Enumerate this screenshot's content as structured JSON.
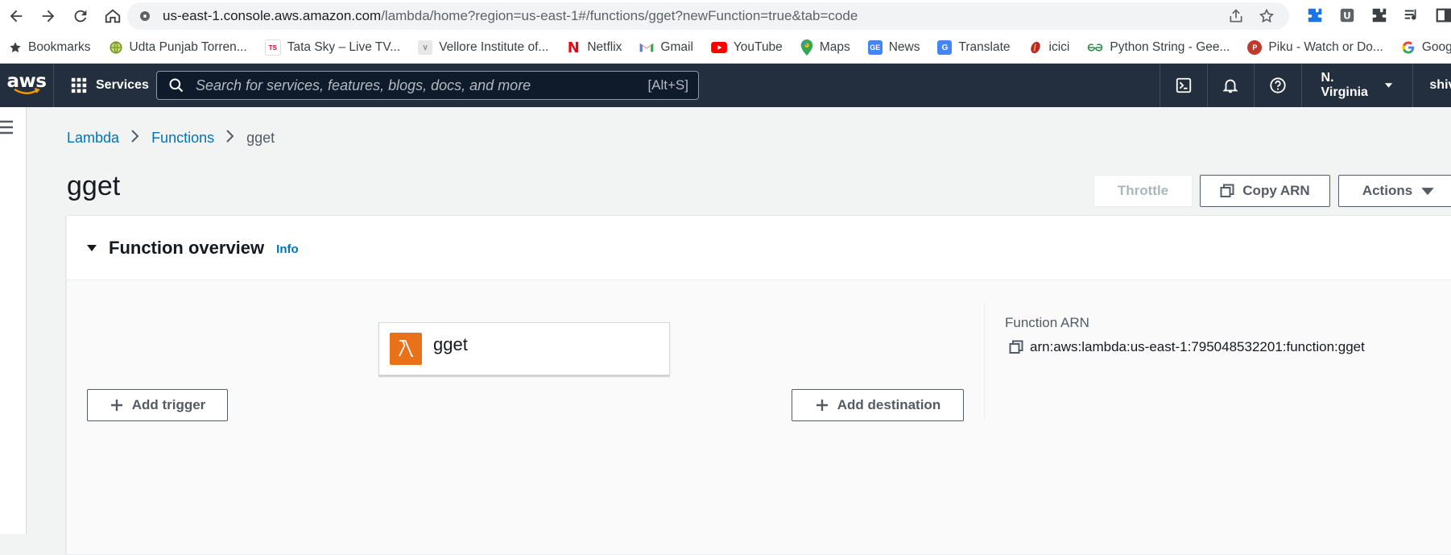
{
  "browser": {
    "url_host": "us-east-1.console.aws.amazon.com",
    "url_path": "/lambda/home?region=us-east-1#/functions/gget?newFunction=true&tab=code",
    "bookmarks": [
      {
        "label": "Bookmarks",
        "icon": "star-icon",
        "color": "#3c4043"
      },
      {
        "label": "Udta Punjab Torren...",
        "icon": "globe-icon",
        "color": "#6b8e23"
      },
      {
        "label": "Tata Sky – Live TV...",
        "icon": "tatasky-icon",
        "color": "#e4002b"
      },
      {
        "label": "Vellore Institute of...",
        "icon": "vit-icon",
        "color": "#7b7b7b"
      },
      {
        "label": "Netflix",
        "icon": "netflix-icon",
        "color": "#e50914"
      },
      {
        "label": "Gmail",
        "icon": "gmail-icon",
        "color": "#ea4335"
      },
      {
        "label": "YouTube",
        "icon": "youtube-icon",
        "color": "#ff0000"
      },
      {
        "label": "Maps",
        "icon": "maps-icon",
        "color": "#34a853"
      },
      {
        "label": "News",
        "icon": "news-icon",
        "color": "#4285f4"
      },
      {
        "label": "Translate",
        "icon": "translate-icon",
        "color": "#4285f4"
      },
      {
        "label": "icici",
        "icon": "icici-icon",
        "color": "#b02a30"
      },
      {
        "label": "Python String - Gee...",
        "icon": "gfg-icon",
        "color": "#2f8d46"
      },
      {
        "label": "Piku - Watch or Do...",
        "icon": "piku-icon",
        "color": "#c0392b"
      },
      {
        "label": "Google",
        "icon": "google-icon",
        "color": "#4285f4"
      }
    ]
  },
  "awsnav": {
    "logo": "aws",
    "services_label": "Services",
    "search_placeholder": "Search for services, features, blogs, docs, and more",
    "search_hint": "[Alt+S]",
    "region": "N. Virginia",
    "user": "shiv"
  },
  "breadcrumb": {
    "items": [
      "Lambda",
      "Functions"
    ],
    "current": "gget"
  },
  "page": {
    "title": "gget",
    "buttons": {
      "throttle": "Throttle",
      "copy_arn": "Copy ARN",
      "actions": "Actions"
    }
  },
  "overview": {
    "title": "Function overview",
    "info": "Info",
    "function_name": "gget",
    "add_trigger": "Add trigger",
    "add_destination": "Add destination",
    "arn_label": "Function ARN",
    "arn_value": "arn:aws:lambda:us-east-1:795048532201:function:gget"
  },
  "colors": {
    "aws_nav_bg": "#232f3e",
    "link": "#0073bb",
    "lambda_orange": "#e8711a"
  }
}
